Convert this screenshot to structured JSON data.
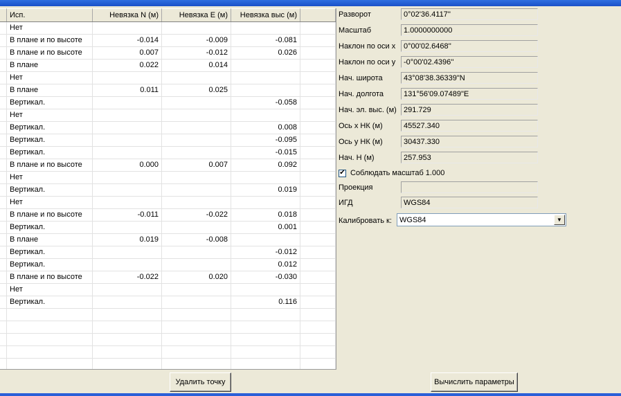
{
  "grid": {
    "headers": [
      "Исп.",
      "Невязка N (м)",
      "Невязка E (м)",
      "Невязка выс (м)"
    ],
    "rows": [
      {
        "use": "Нет",
        "dn": "",
        "de": "",
        "dh": ""
      },
      {
        "use": "В плане и по высоте",
        "dn": "-0.014",
        "de": "-0.009",
        "dh": "-0.081"
      },
      {
        "use": "В плане и по высоте",
        "dn": "0.007",
        "de": "-0.012",
        "dh": "0.026"
      },
      {
        "use": "В плане",
        "dn": "0.022",
        "de": "0.014",
        "dh": ""
      },
      {
        "use": "Нет",
        "dn": "",
        "de": "",
        "dh": ""
      },
      {
        "use": "В плане",
        "dn": "0.011",
        "de": "0.025",
        "dh": ""
      },
      {
        "use": "Вертикал.",
        "dn": "",
        "de": "",
        "dh": "-0.058"
      },
      {
        "use": "Нет",
        "dn": "",
        "de": "",
        "dh": ""
      },
      {
        "use": "Вертикал.",
        "dn": "",
        "de": "",
        "dh": "0.008"
      },
      {
        "use": "Вертикал.",
        "dn": "",
        "de": "",
        "dh": "-0.095"
      },
      {
        "use": "Вертикал.",
        "dn": "",
        "de": "",
        "dh": "-0.015"
      },
      {
        "use": "В плане и по высоте",
        "dn": "0.000",
        "de": "0.007",
        "dh": "0.092"
      },
      {
        "use": "Нет",
        "dn": "",
        "de": "",
        "dh": ""
      },
      {
        "use": "Вертикал.",
        "dn": "",
        "de": "",
        "dh": "0.019"
      },
      {
        "use": "Нет",
        "dn": "",
        "de": "",
        "dh": ""
      },
      {
        "use": "В плане и по высоте",
        "dn": "-0.011",
        "de": "-0.022",
        "dh": "0.018"
      },
      {
        "use": "Вертикал.",
        "dn": "",
        "de": "",
        "dh": "0.001"
      },
      {
        "use": "В плане",
        "dn": "0.019",
        "de": "-0.008",
        "dh": ""
      },
      {
        "use": "Вертикал.",
        "dn": "",
        "de": "",
        "dh": "-0.012"
      },
      {
        "use": "Вертикал.",
        "dn": "",
        "de": "",
        "dh": "0.012"
      },
      {
        "use": "В плане и по высоте",
        "dn": "-0.022",
        "de": "0.020",
        "dh": "-0.030"
      },
      {
        "use": "Нет",
        "dn": "",
        "de": "",
        "dh": ""
      },
      {
        "use": "Вертикал.",
        "dn": "",
        "de": "",
        "dh": "0.116"
      },
      {
        "use": "",
        "dn": "",
        "de": "",
        "dh": ""
      },
      {
        "use": "",
        "dn": "",
        "de": "",
        "dh": ""
      },
      {
        "use": "",
        "dn": "",
        "de": "",
        "dh": ""
      },
      {
        "use": "",
        "dn": "",
        "de": "",
        "dh": ""
      },
      {
        "use": "",
        "dn": "",
        "de": "",
        "dh": ""
      },
      {
        "use": "",
        "dn": "",
        "de": "",
        "dh": ""
      }
    ]
  },
  "params": [
    {
      "label": "Разворот",
      "value": "0°02'36.4117''"
    },
    {
      "label": "Масштаб",
      "value": "1.0000000000"
    },
    {
      "label": "Наклон по оси x",
      "value": "0°00'02.6468''"
    },
    {
      "label": "Наклон по оси y",
      "value": "-0°00'02.4396''"
    },
    {
      "label": "Нач. широта",
      "value": "43°08'38.36339\"N"
    },
    {
      "label": "Нач. долгота",
      "value": "131°56'09.07489\"E"
    },
    {
      "label": "Нач. эл. выс. (м)",
      "value": "291.729"
    },
    {
      "label": "Ось x НК (м)",
      "value": "45527.340"
    },
    {
      "label": "Ось y НК (м)",
      "value": "30437.330"
    },
    {
      "label": "Нач. Н (м)",
      "value": "257.953"
    }
  ],
  "keep_scale": {
    "label": "Соблюдать масштаб 1.000",
    "checked": true,
    "mark": "✔"
  },
  "projection": {
    "label": "Проекция",
    "value": ""
  },
  "igd": {
    "label": "ИГД",
    "value": "WGS84"
  },
  "calibrate": {
    "label": "Калибровать к:",
    "value": "WGS84"
  },
  "buttons": {
    "delete_point": "Удалить точку",
    "compute": "Вычислить параметры"
  },
  "icons": {
    "dropdown": "chevron-down-icon",
    "check": "check-icon"
  }
}
